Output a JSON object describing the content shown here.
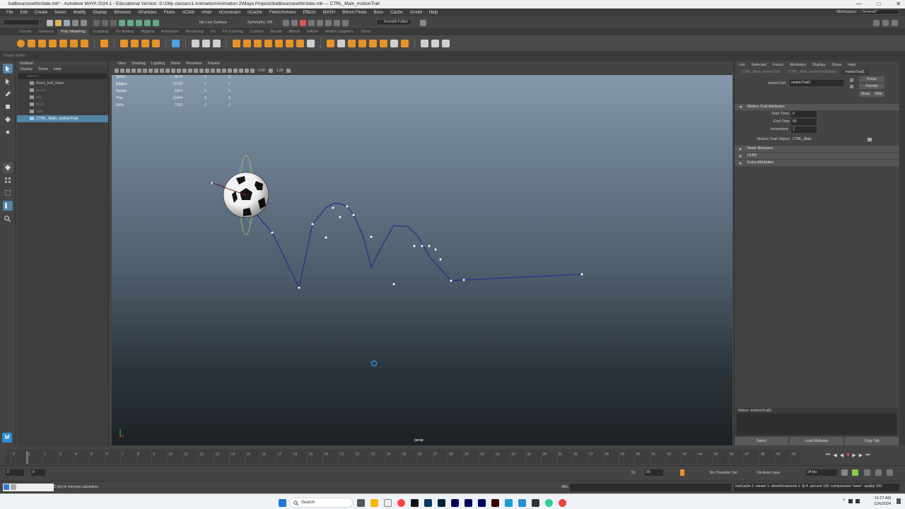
{
  "window": {
    "title": "ballbouncewithrotate.mb* - Autodesk MAYA 2024.1 - Educational Version: S:\\1My classes\\1-Animation\\Animation 2\\Maya Projects\\ballbouncewithrotate.mb  ---  CTRL_Main_motionTrail"
  },
  "menubar": {
    "items": [
      "File",
      "Edit",
      "Create",
      "Select",
      "Modify",
      "Display",
      "Windows",
      "nParticles",
      "Fluids",
      "nCloth",
      "nHair",
      "nConstraint",
      "nCache",
      "Fields/Solvers",
      "Effects",
      "MASH",
      "Bifrost Fluids",
      "Boss",
      "Cache",
      "Arnold",
      "Help"
    ],
    "workspace_label": "Workspace:",
    "workspace_value": "General*"
  },
  "statusline": {
    "live_surface": "No Live Surface",
    "symmetry": "Symmetry: Off",
    "user": "Kenneth Fulton"
  },
  "shelf": {
    "tabs": [
      "Curves",
      "Surfaces",
      "Poly Modeling",
      "Sculpting",
      "UV Editing",
      "Rigging",
      "Animation",
      "Rendering",
      "FX",
      "FX Caching",
      "Custom",
      "Arnold",
      "Bifrost",
      "MASH",
      "Motion Graphics",
      "XGen"
    ],
    "active_tab": "Poly Modeling"
  },
  "graph_editor_label": "Graph Editor",
  "outliner": {
    "title": "Outliner",
    "menu": [
      "Display",
      "Show",
      "Help"
    ],
    "search_placeholder": "Search...",
    "rows": [
      {
        "label": "Anim_ball_Main",
        "dim": false,
        "selected": false
      },
      {
        "label": "persp",
        "dim": true,
        "selected": false
      },
      {
        "label": "top",
        "dim": true,
        "selected": false
      },
      {
        "label": "front",
        "dim": true,
        "selected": false
      },
      {
        "label": "side",
        "dim": true,
        "selected": false
      },
      {
        "label": "CTRL_Main_motionTrail",
        "dim": false,
        "selected": true
      }
    ]
  },
  "viewport": {
    "menu": [
      "View",
      "Shading",
      "Lighting",
      "Show",
      "Renderer",
      "Panels"
    ],
    "exposure": "0.00",
    "gamma": "1.00",
    "hud": [
      {
        "label": "Verts:",
        "v1": "6676",
        "v2": "0",
        "v3": "0"
      },
      {
        "label": "Edges:",
        "v1": "13199",
        "v2": "0",
        "v3": "0"
      },
      {
        "label": "Faces:",
        "v1": "6264",
        "v2": "0",
        "v3": "0"
      },
      {
        "label": "Tris:",
        "v1": "12444",
        "v2": "0",
        "v3": "0"
      },
      {
        "label": "UVs:",
        "v1": "7539",
        "v2": "0",
        "v3": "0"
      }
    ],
    "camera_label": "persp"
  },
  "attribute_editor": {
    "menu": [
      "List",
      "Selected",
      "Focus",
      "Attributes",
      "Display",
      "Show",
      "Help"
    ],
    "tabs": [
      "CTRL_Main_motionTrail",
      "CTRL_Main_motionTrailShape",
      "motionTrail1"
    ],
    "active_tab": "motionTrail1",
    "node_label": "motionTrail:",
    "node_value": "motionTrail1",
    "buttons": {
      "focus": "Focus",
      "presets": "Presets",
      "show": "Show",
      "hide": "Hide"
    },
    "sections": {
      "motion_trail": "Motion Trail Attributes",
      "node_behavior": "Node Behavior",
      "uuid": "UUID",
      "extra": "Extra Attributes"
    },
    "attrs": [
      {
        "label": "Start Time",
        "value": "0"
      },
      {
        "label": "End Time",
        "value": "50"
      },
      {
        "label": "Increment",
        "value": "1"
      }
    ],
    "trail_object_label": "Motion Trail Object",
    "trail_object_value": "CTRL_Main",
    "notes_label": "Notes:  motionTrail1",
    "bottom_buttons": [
      "Select",
      "Load Attributes",
      "Copy Tab"
    ]
  },
  "timeline": {
    "ticks": [
      "0",
      "1",
      "2",
      "3",
      "4",
      "5",
      "6",
      "7",
      "8",
      "9",
      "10",
      "11",
      "12",
      "13",
      "14",
      "15",
      "16",
      "17",
      "18",
      "19",
      "20",
      "21",
      "22",
      "23",
      "24",
      "25",
      "26",
      "27",
      "28",
      "29",
      "30",
      "31",
      "32",
      "33",
      "34",
      "35",
      "36",
      "37",
      "38",
      "39",
      "40",
      "41",
      "42",
      "43",
      "44",
      "45",
      "46",
      "47",
      "48",
      "49",
      "50"
    ],
    "current_frame": "1"
  },
  "range": {
    "start": "0",
    "range_start": "0",
    "range_end": "50",
    "end": "50",
    "character_set": "No Character Set",
    "anim_layer": "No Anim Layer",
    "fps": "24 fps"
  },
  "cmdline": {
    "help_text": "C key to interrupt calculation.",
    "mel_label": "MEL",
    "result": "lowCache 1 -viewer 1 -showOrnaments 1 -fp 4 -percent 100 -compression \"none\" -quality 100;"
  },
  "taskbar": {
    "search_label": "Search",
    "time": "11:27 AM",
    "date": "11/6/2024"
  },
  "colors": {
    "selection": "#5285a6",
    "trail": "#2a2f8a",
    "shelf_icon": "#e8922a"
  }
}
